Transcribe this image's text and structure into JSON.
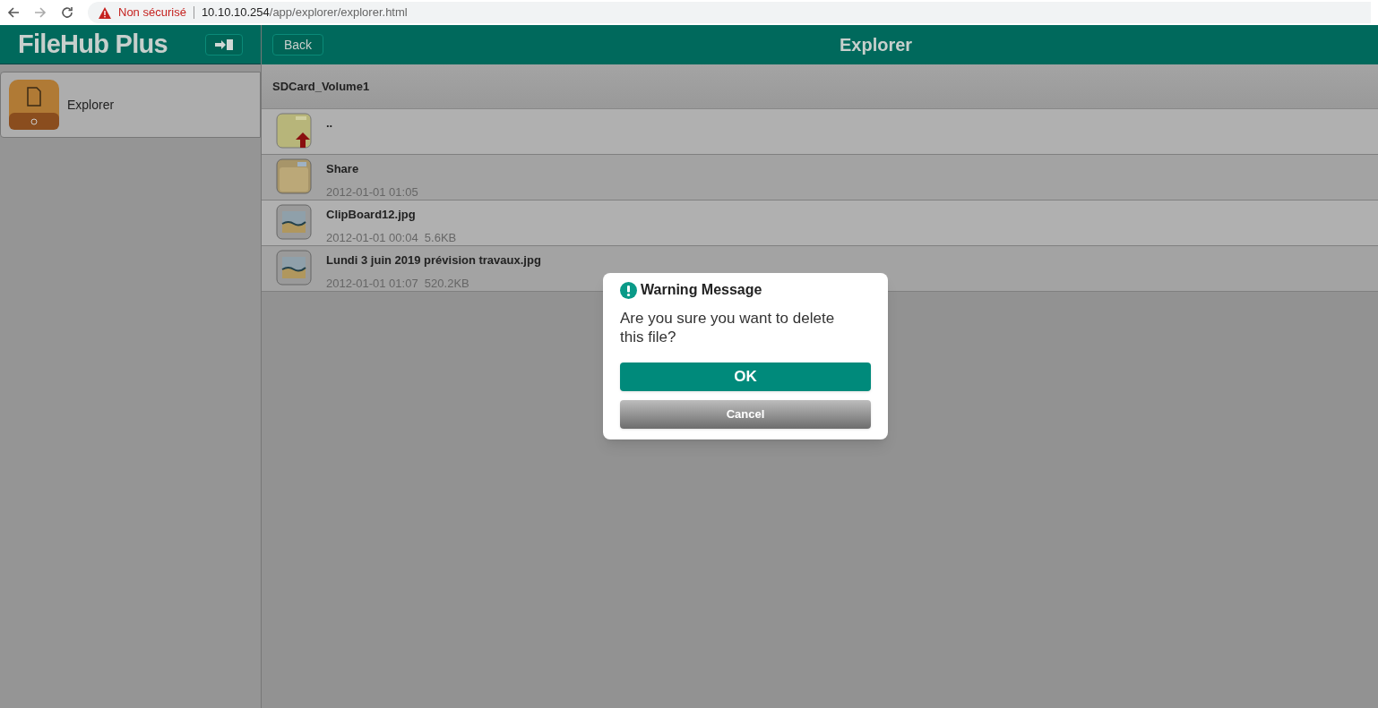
{
  "browser": {
    "security": "Non sécurisé",
    "url_host": "10.10.10.254",
    "url_path": "/app/explorer/explorer.html"
  },
  "app": {
    "logo": "FileHub Plus",
    "back": "Back",
    "title": "Explorer"
  },
  "sidebar": {
    "items": [
      {
        "label": "Explorer",
        "selected": true
      }
    ]
  },
  "breadcrumb": "SDCard_Volume1",
  "files": [
    {
      "kind": "parent",
      "name": ".."
    },
    {
      "kind": "folder",
      "name": "Share",
      "date": "2012-01-01 01:05"
    },
    {
      "kind": "image",
      "name": "ClipBoard12.jpg",
      "date": "2012-01-01 00:04",
      "size": "5.6KB"
    },
    {
      "kind": "image",
      "name": "Lundi 3 juin 2019 prévision travaux.jpg",
      "date": "2012-01-01 01:07",
      "size": "520.2KB"
    }
  ],
  "dialog": {
    "title": "Warning Message",
    "message": "Are you sure you want to delete this file?",
    "buttons": [
      "OK",
      "Cancel"
    ]
  }
}
